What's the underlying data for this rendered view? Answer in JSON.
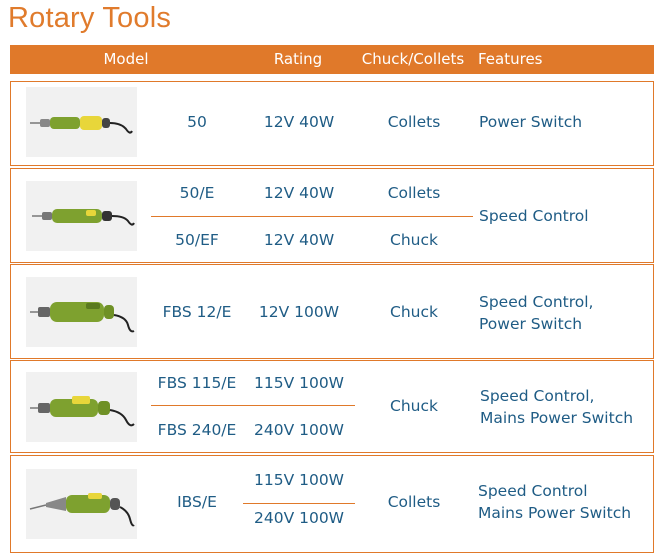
{
  "title": "Rotary Tools",
  "header": {
    "model": "Model",
    "rating": "Rating",
    "chuck": "Chuck/Collets",
    "features": "Features"
  },
  "colors": {
    "accent": "#e0792a",
    "text": "#1f5c85",
    "tool_body": "#7ea12f",
    "tool_band": "#e8d63a"
  },
  "rows": [
    {
      "image": "rotary-tool-50-photo",
      "models": [
        "50"
      ],
      "ratings": [
        "12V 40W"
      ],
      "chuck": [
        "Collets"
      ],
      "features": [
        "Power Switch"
      ]
    },
    {
      "image": "rotary-tool-50e-photo",
      "models": [
        "50/E",
        "50/EF"
      ],
      "ratings": [
        "12V 40W",
        "12V 40W"
      ],
      "chuck": [
        "Collets",
        "Chuck"
      ],
      "features": [
        "Speed Control"
      ]
    },
    {
      "image": "rotary-tool-fbs12e-photo",
      "models": [
        "FBS 12/E"
      ],
      "ratings": [
        "12V 100W"
      ],
      "chuck": [
        "Chuck"
      ],
      "features": [
        "Speed Control,",
        "Power Switch"
      ]
    },
    {
      "image": "rotary-tool-fbs115e-photo",
      "models": [
        "FBS 115/E",
        "FBS 240/E"
      ],
      "ratings": [
        "115V 100W",
        "240V 100W"
      ],
      "chuck": [
        "Chuck"
      ],
      "features": [
        "Speed Control,",
        "Mains Power Switch"
      ]
    },
    {
      "image": "rotary-tool-ibse-photo",
      "models": [
        "IBS/E"
      ],
      "ratings": [
        "115V 100W",
        "240V 100W"
      ],
      "chuck": [
        "Collets"
      ],
      "features": [
        "Speed Control",
        "Mains Power Switch"
      ]
    }
  ]
}
